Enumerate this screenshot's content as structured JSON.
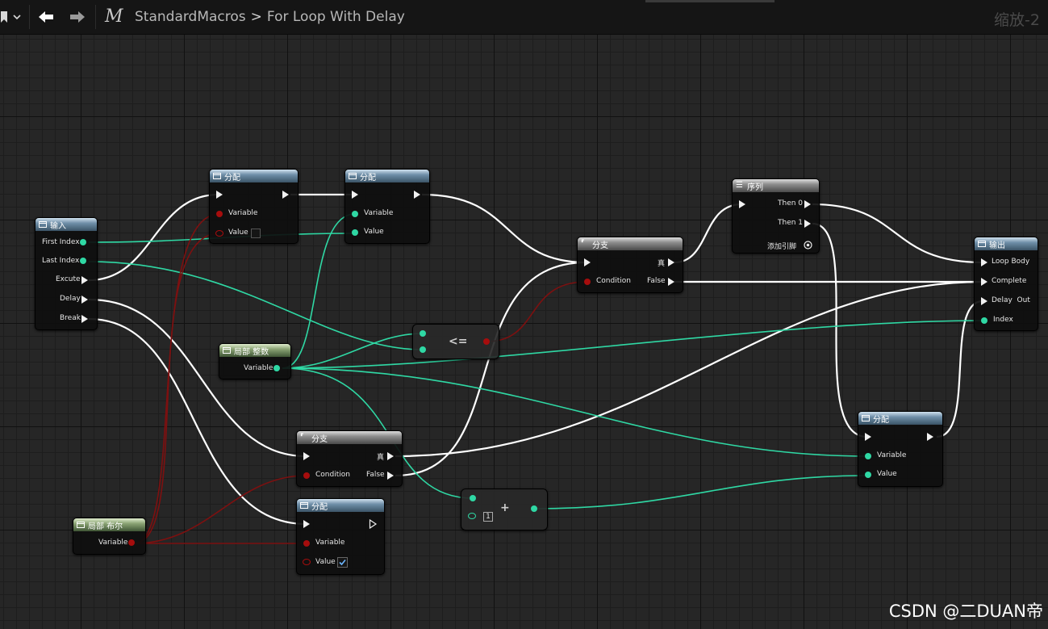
{
  "toolbar": {
    "macro_letter": "M",
    "breadcrumb_root": "StandardMacros",
    "breadcrumb_separator": ">",
    "breadcrumb_leaf": "For Loop With Delay",
    "zoom": "缩放-2"
  },
  "nodes": {
    "input": {
      "title": "输入",
      "pins": [
        "First Index",
        "Last Index",
        "Excute",
        "Delay",
        "Break"
      ]
    },
    "assign_top1": {
      "title": "分配",
      "variable": "Variable",
      "value": "Value"
    },
    "assign_top2": {
      "title": "分配",
      "variable": "Variable",
      "value": "Value"
    },
    "local_int": {
      "title": "局部 整数",
      "variable": "Variable"
    },
    "compare": {
      "operator": "<="
    },
    "branch_mid": {
      "title": "分支",
      "true": "真",
      "condition": "Condition",
      "false": "False"
    },
    "sequence": {
      "title": "序列",
      "then0": "Then 0",
      "then1": "Then 1",
      "add_pin": "添加引脚"
    },
    "output": {
      "title": "输出",
      "pins": [
        "Loop Body",
        "Complete",
        "Delay  Out",
        "Index"
      ]
    },
    "branch_low": {
      "title": "分支",
      "true": "真",
      "condition": "Condition",
      "false": "False"
    },
    "assign_low": {
      "title": "分配",
      "variable": "Variable",
      "value": "Value"
    },
    "local_bool": {
      "title": "局部 布尔",
      "variable": "Variable"
    },
    "add": {
      "operator": "+",
      "constant": "1"
    },
    "assign_right": {
      "title": "分配",
      "variable": "Variable",
      "value": "Value"
    }
  },
  "colors": {
    "exec_wire": "#ffffff",
    "int_wire": "#2fd8a4",
    "bool_wire": "#8a1212",
    "node_header": "#4f6b80",
    "local_var_header": "#5a7a4a"
  },
  "watermark": "CSDN @二DUAN帝"
}
